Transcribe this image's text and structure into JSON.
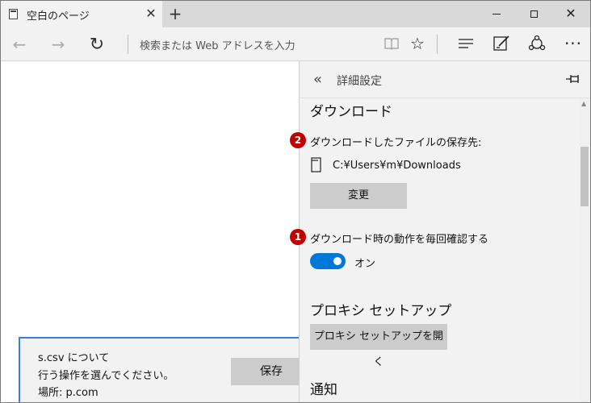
{
  "tab": {
    "title": "空白のページ",
    "close_glyph": "✕",
    "new_tab_glyph": "+"
  },
  "window_controls": {
    "close_glyph": "✕"
  },
  "nav": {
    "back_glyph": "←",
    "forward_glyph": "→",
    "refresh_glyph": "↻",
    "address_placeholder": "検索または Web アドレスを入力",
    "star_glyph": "☆",
    "more_glyph": "···"
  },
  "download_bar": {
    "line1": "s.csv について",
    "line2": "行う操作を選んでください。",
    "line3": "場所: p.com",
    "save_label": "保存",
    "border_color": "#3a7fd5"
  },
  "settings_panel": {
    "back_glyph": "«",
    "title": "詳細設定",
    "download_section": {
      "heading": "ダウンロード",
      "location_label": "ダウンロードしたファイルの保存先:",
      "location_path": "C:¥Users¥m¥Downloads",
      "change_button": "変更",
      "ask_label": "ダウンロード時の動作を毎回確認する",
      "ask_toggle_state": "オン",
      "ask_toggle_on": true
    },
    "proxy_section": {
      "heading": "プロキシ セットアップ",
      "open_button": "プロキシ セットアップを開く"
    },
    "notify_section": {
      "heading": "通知"
    },
    "accent_color": "#0078d7"
  },
  "annotations": {
    "badge_location": "2",
    "badge_ask": "1",
    "badge_color": "#c00000"
  }
}
